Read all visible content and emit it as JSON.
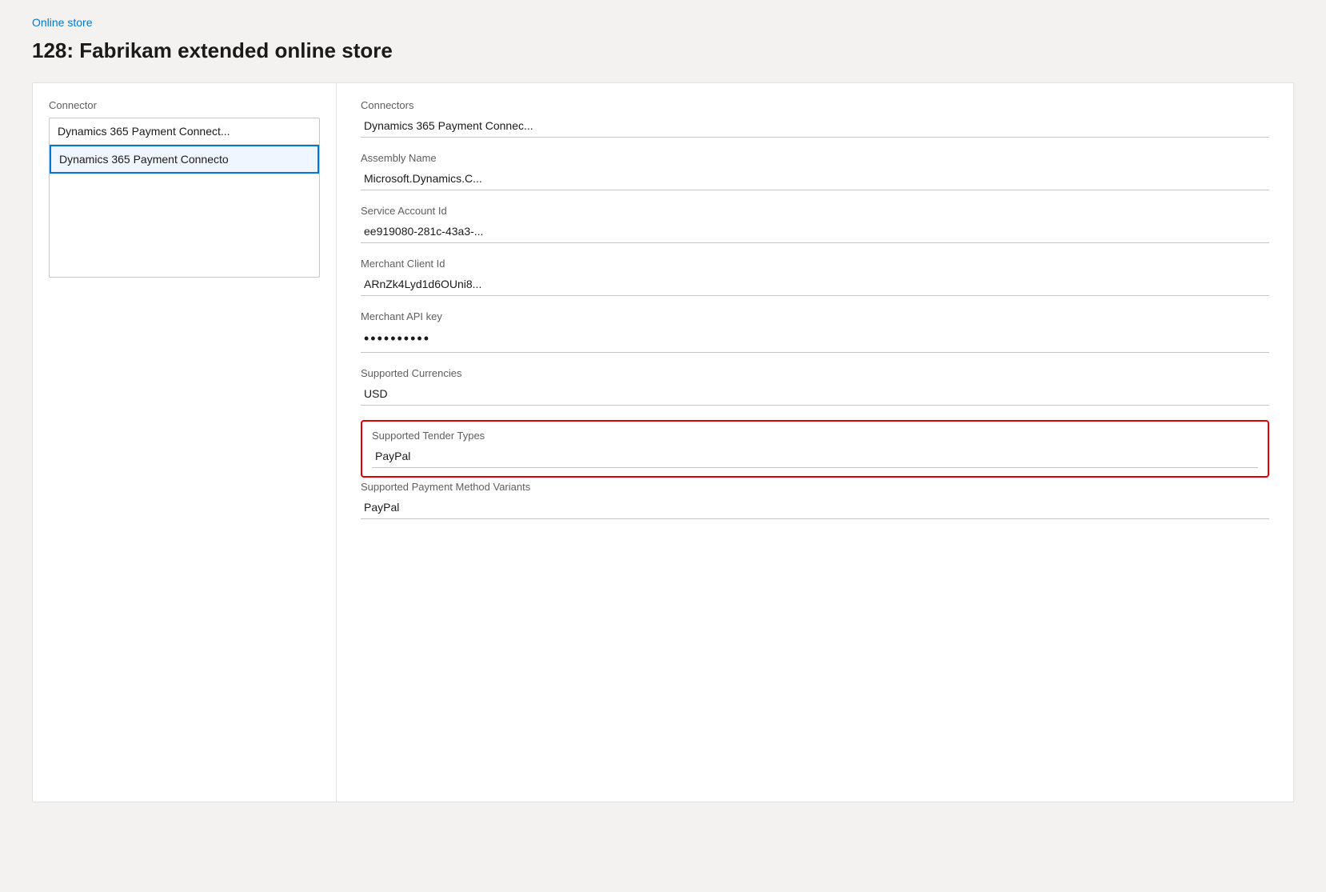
{
  "breadcrumb": {
    "label": "Online store",
    "link": "#"
  },
  "page": {
    "title": "128: Fabrikam extended online store"
  },
  "left_panel": {
    "label": "Connector",
    "items": [
      {
        "id": 1,
        "text": "Dynamics 365 Payment Connect...",
        "selected": false
      },
      {
        "id": 2,
        "text": "Dynamics 365 Payment Connecto",
        "selected": true
      }
    ]
  },
  "right_panel": {
    "fields": [
      {
        "id": "connectors",
        "label": "Connectors",
        "value": "Dynamics 365 Payment Connec...",
        "highlighted": false,
        "is_password": false
      },
      {
        "id": "assembly_name",
        "label": "Assembly Name",
        "value": "Microsoft.Dynamics.C...",
        "highlighted": false,
        "is_password": false
      },
      {
        "id": "service_account_id",
        "label": "Service Account Id",
        "value": "ee919080-281c-43a3-...",
        "highlighted": false,
        "is_password": false
      },
      {
        "id": "merchant_client_id",
        "label": "Merchant Client Id",
        "value": "ARnZk4Lyd1d6OUni8...",
        "highlighted": false,
        "is_password": false
      },
      {
        "id": "merchant_api_key",
        "label": "Merchant API key",
        "value": "••••••••••",
        "highlighted": false,
        "is_password": true
      },
      {
        "id": "supported_currencies",
        "label": "Supported Currencies",
        "value": "USD",
        "highlighted": false,
        "is_password": false
      },
      {
        "id": "supported_tender_types",
        "label": "Supported Tender Types",
        "value": "PayPal",
        "highlighted": true,
        "is_password": false
      },
      {
        "id": "supported_payment_method_variants",
        "label": "Supported Payment Method Variants",
        "value": "PayPal",
        "highlighted": false,
        "is_password": false
      }
    ]
  }
}
